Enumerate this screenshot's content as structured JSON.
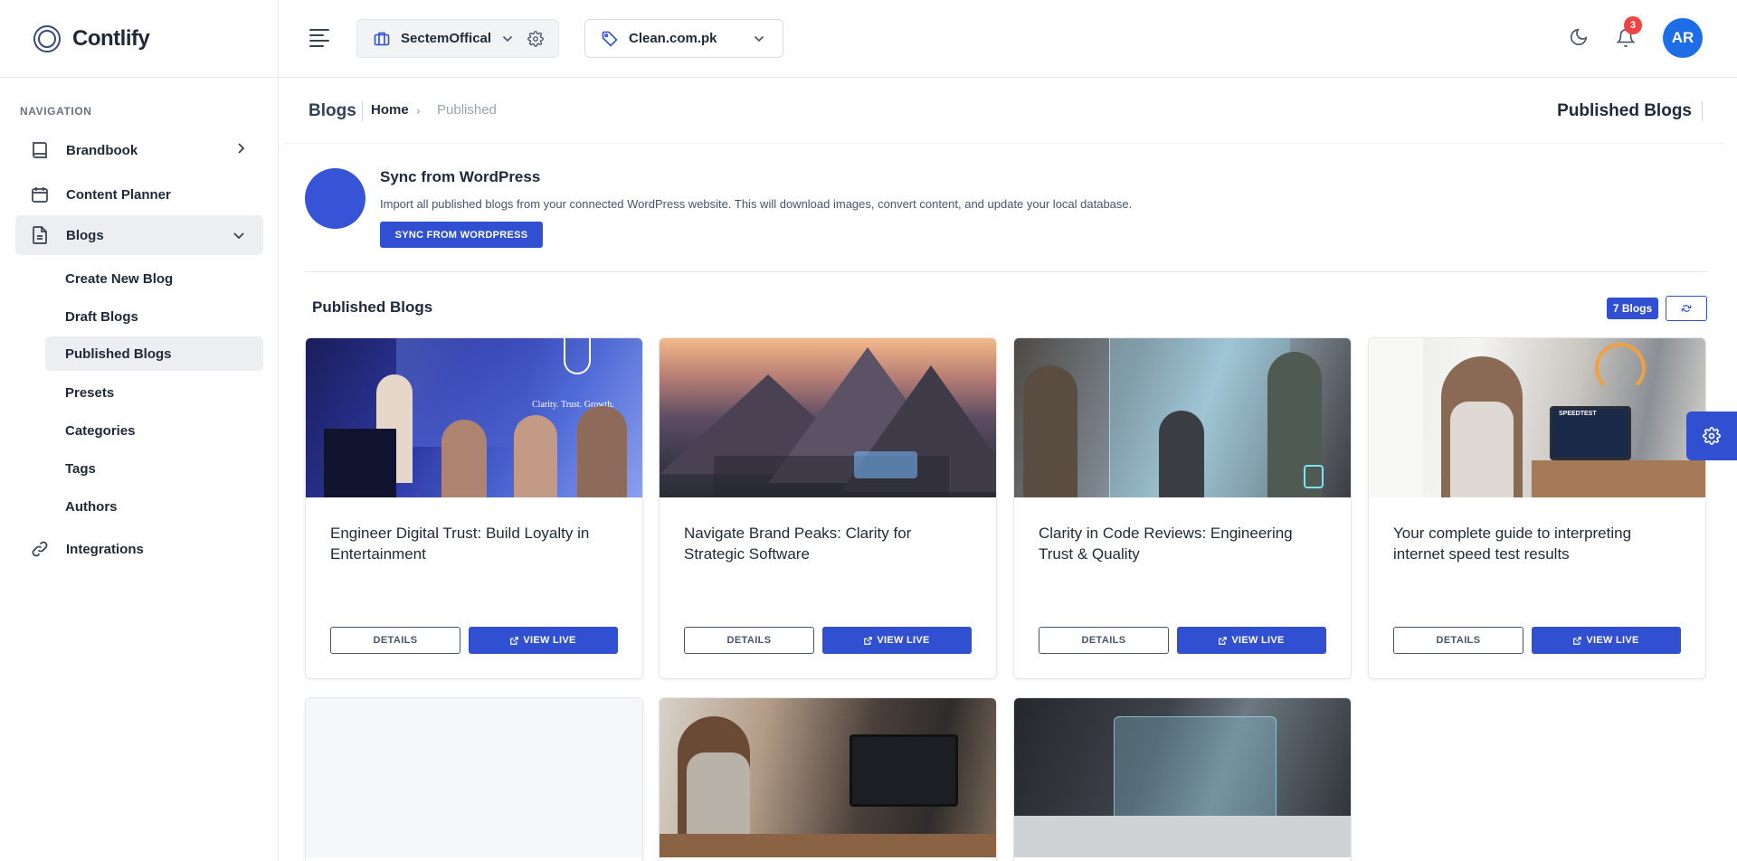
{
  "app": {
    "name": "Contlify"
  },
  "sidebar": {
    "section_label": "NAVIGATION",
    "items": [
      {
        "label": "Brandbook",
        "icon": "book-icon"
      },
      {
        "label": "Content Planner",
        "icon": "calendar-icon"
      },
      {
        "label": "Blogs",
        "icon": "document-icon"
      },
      {
        "label": "Integrations",
        "icon": "link-icon"
      }
    ],
    "blog_sub_items": [
      {
        "label": "Create New Blog"
      },
      {
        "label": "Draft Blogs"
      },
      {
        "label": "Published Blogs"
      },
      {
        "label": "Presets"
      },
      {
        "label": "Categories"
      },
      {
        "label": "Tags"
      },
      {
        "label": "Authors"
      }
    ]
  },
  "topbar": {
    "org_selector": "SectemOffical",
    "site_selector": "Clean.com.pk",
    "notification_count": "3",
    "avatar_initials": "AR"
  },
  "breadcrumb": {
    "page_title": "Blogs",
    "home": "Home",
    "separator": "›",
    "current": "Published",
    "right_title": "Published Blogs"
  },
  "sync": {
    "title": "Sync from WordPress",
    "description": "Import all published blogs from your connected WordPress website. This will download images, convert content, and update your local database.",
    "button": "SYNC FROM WORDPRESS"
  },
  "published": {
    "title": "Published Blogs",
    "count_badge": "7 Blogs",
    "details_label": "DETAILS",
    "view_live_label": "VIEW LIVE",
    "cards": [
      {
        "title": "Engineer Digital Trust: Build Loyalty in Entertainment",
        "image_overlay": "Clarity. Trust. Growth."
      },
      {
        "title": "Navigate Brand Peaks: Clarity for Strategic Software"
      },
      {
        "title": "Clarity in Code Reviews: Engineering Trust & Quality"
      },
      {
        "title": "Your complete guide to interpreting internet speed test results",
        "image_overlay": "SPEEDTEST"
      }
    ]
  },
  "colors": {
    "primary": "#3050d1",
    "avatar": "#1d6ee6",
    "badge": "#ef4444",
    "active_bg": "#eceef1"
  }
}
